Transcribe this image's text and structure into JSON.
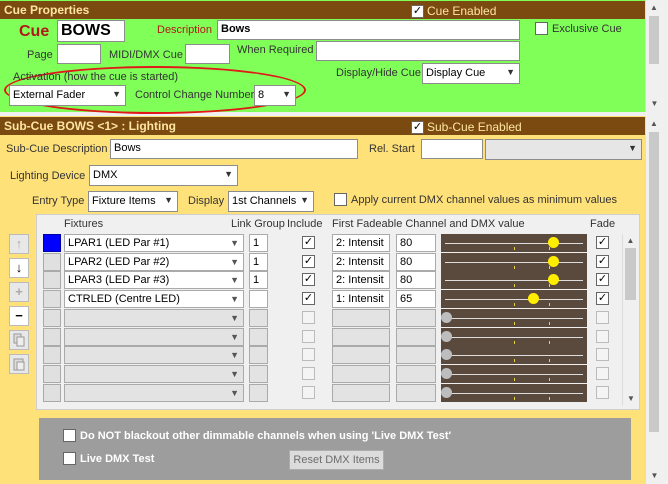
{
  "cue_props": {
    "header": "Cue Properties",
    "cue_enabled_label": "Cue Enabled",
    "cue_label": "Cue",
    "cue_value": "BOWS",
    "description_label": "Description",
    "description_value": "Bows",
    "exclusive_cue_label": "Exclusive Cue",
    "page_label": "Page",
    "page_value": "",
    "midi_label": "MIDI/DMX Cue",
    "midi_value": "",
    "when_required_label": "When Required",
    "when_required_value": "",
    "activation_label": "Activation (how the cue is started)",
    "activation_value": "External Fader",
    "cc_number_label": "Control Change Number",
    "cc_number_value": "8",
    "display_hide_label": "Display/Hide Cue",
    "display_hide_value": "Display Cue"
  },
  "sub_cue": {
    "header": "Sub-Cue BOWS <1> : Lighting",
    "enabled_label": "Sub-Cue Enabled",
    "desc_label": "Sub-Cue Description",
    "desc_value": "Bows",
    "rel_start_label": "Rel. Start",
    "rel_start_value": "",
    "lighting_device_label": "Lighting Device",
    "lighting_device_value": "DMX",
    "entry_type_label": "Entry Type",
    "entry_type_value": "Fixture Items",
    "display_label": "Display",
    "display_value": "1st Channels",
    "apply_label": "Apply current DMX channel values as minimum values"
  },
  "grid": {
    "col_fixtures": "Fixtures",
    "col_link_group": "Link Group",
    "col_include": "Include",
    "col_channel": "First Fadeable Channel and DMX value",
    "col_fade": "Fade",
    "rows": [
      {
        "fixture": "LPAR1 (LED Par #1)",
        "link": "1",
        "include": "✓",
        "channel": "2: Intensit",
        "value": "80",
        "fade": "✓",
        "level": 0.8
      },
      {
        "fixture": "LPAR2 (LED Par #2)",
        "link": "1",
        "include": "✓",
        "channel": "2: Intensit",
        "value": "80",
        "fade": "✓",
        "level": 0.8
      },
      {
        "fixture": "LPAR3 (LED Par #3)",
        "link": "1",
        "include": "✓",
        "channel": "2: Intensit",
        "value": "80",
        "fade": "✓",
        "level": 0.8
      },
      {
        "fixture": "CTRLED (Centre LED)",
        "link": "",
        "include": "✓",
        "channel": "1: Intensit",
        "value": "65",
        "fade": "✓",
        "level": 0.65
      },
      {
        "fixture": "",
        "link": "",
        "include": "",
        "channel": "",
        "value": "",
        "fade": "",
        "level": 0
      },
      {
        "fixture": "",
        "link": "",
        "include": "",
        "channel": "",
        "value": "",
        "fade": "",
        "level": 0
      },
      {
        "fixture": "",
        "link": "",
        "include": "",
        "channel": "",
        "value": "",
        "fade": "",
        "level": 0
      },
      {
        "fixture": "",
        "link": "",
        "include": "",
        "channel": "",
        "value": "",
        "fade": "",
        "level": 0
      },
      {
        "fixture": "",
        "link": "",
        "include": "",
        "channel": "",
        "value": "",
        "fade": "",
        "level": 0
      }
    ]
  },
  "bottom": {
    "no_blackout_label": "Do NOT blackout other dimmable channels when using 'Live DMX Test'",
    "live_test_label": "Live DMX Test",
    "reset_button": "Reset DMX Items"
  },
  "tools": {
    "up": "↑",
    "down": "↓",
    "plus": "+",
    "minus": "−"
  },
  "colors": {
    "header_bg": "#7a4a10",
    "header_text": "#ffe6a0",
    "cue_panel_bg": "#80ff58",
    "sub_panel_bg": "#ffe17a",
    "activation_outline": "#e01818",
    "slider_knob": "#ffee00",
    "row_marker": "#0000ff"
  }
}
